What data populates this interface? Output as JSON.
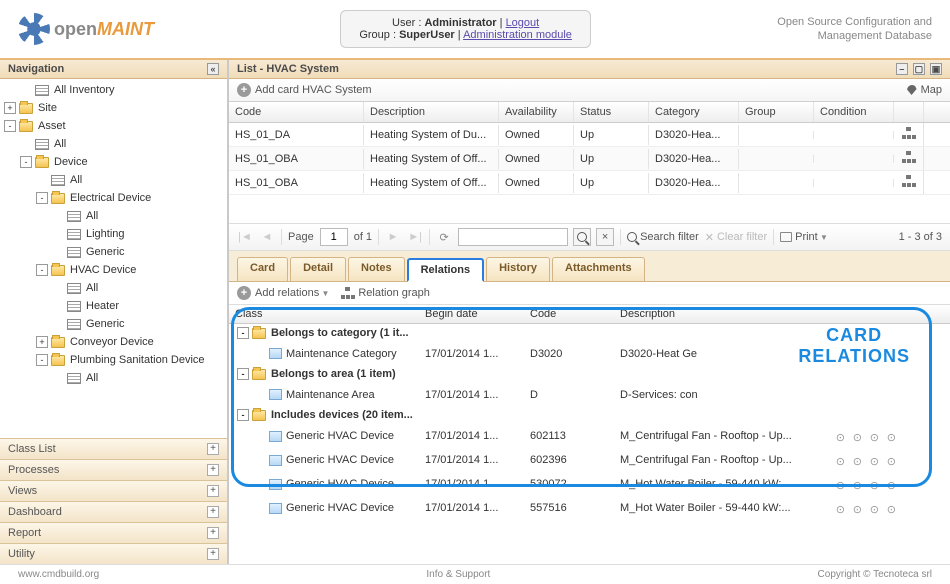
{
  "brand": {
    "part1": "open",
    "part2": "MAINT"
  },
  "header": {
    "user_label": "User :",
    "user": "Administrator",
    "logout": "Logout",
    "group_label": "Group :",
    "group": "SuperUser",
    "admin_module": "Administration module",
    "tagline1": "Open Source Configuration and",
    "tagline2": "Management Database"
  },
  "nav": {
    "title": "Navigation",
    "tree": [
      {
        "lvl": 1,
        "t": "grid",
        "exp": "",
        "label": "All Inventory"
      },
      {
        "lvl": 0,
        "t": "folder",
        "exp": "+",
        "label": "Site"
      },
      {
        "lvl": 0,
        "t": "folder",
        "exp": "-",
        "label": "Asset"
      },
      {
        "lvl": 1,
        "t": "grid",
        "exp": "",
        "label": "All"
      },
      {
        "lvl": 1,
        "t": "folder",
        "exp": "-",
        "label": "Device"
      },
      {
        "lvl": 2,
        "t": "grid",
        "exp": "",
        "label": "All"
      },
      {
        "lvl": 2,
        "t": "folder",
        "exp": "-",
        "label": "Electrical Device"
      },
      {
        "lvl": 3,
        "t": "grid",
        "exp": "",
        "label": "All"
      },
      {
        "lvl": 3,
        "t": "grid",
        "exp": "",
        "label": "Lighting"
      },
      {
        "lvl": 3,
        "t": "grid",
        "exp": "",
        "label": "Generic"
      },
      {
        "lvl": 2,
        "t": "folder",
        "exp": "-",
        "label": "HVAC Device"
      },
      {
        "lvl": 3,
        "t": "grid",
        "exp": "",
        "label": "All"
      },
      {
        "lvl": 3,
        "t": "grid",
        "exp": "",
        "label": "Heater"
      },
      {
        "lvl": 3,
        "t": "grid",
        "exp": "",
        "label": "Generic"
      },
      {
        "lvl": 2,
        "t": "folder",
        "exp": "+",
        "label": "Conveyor Device"
      },
      {
        "lvl": 2,
        "t": "folder",
        "exp": "-",
        "label": "Plumbing Sanitation Device"
      },
      {
        "lvl": 3,
        "t": "grid",
        "exp": "",
        "label": "All"
      }
    ],
    "acc": [
      "Class List",
      "Processes",
      "Views",
      "Dashboard",
      "Report",
      "Utility"
    ]
  },
  "list": {
    "title": "List - HVAC System",
    "add": "Add card HVAC System",
    "map": "Map",
    "cols": {
      "code": "Code",
      "desc": "Description",
      "avail": "Availability",
      "status": "Status",
      "cat": "Category",
      "group": "Group",
      "cond": "Condition"
    },
    "rows": [
      {
        "code": "HS_01_DA",
        "desc": "Heating System of Du...",
        "avail": "Owned",
        "status": "Up",
        "cat": "D3020-Hea...",
        "group": "",
        "cond": ""
      },
      {
        "code": "HS_01_OBA",
        "desc": "Heating System of Off...",
        "avail": "Owned",
        "status": "Up",
        "cat": "D3020-Hea...",
        "group": "",
        "cond": ""
      },
      {
        "code": "HS_01_OBA",
        "desc": "Heating System of Off...",
        "avail": "Owned",
        "status": "Up",
        "cat": "D3020-Hea...",
        "group": "",
        "cond": ""
      }
    ]
  },
  "paging": {
    "page_lbl": "Page",
    "page": "1",
    "of": "of 1",
    "search_filter": "Search filter",
    "clear_filter": "Clear filter",
    "print": "Print",
    "summary": "1 - 3 of 3"
  },
  "tabs": {
    "card": "Card",
    "detail": "Detail",
    "notes": "Notes",
    "relations": "Relations",
    "history": "History",
    "attachments": "Attachments"
  },
  "rel": {
    "add": "Add relations",
    "graph": "Relation graph",
    "cols": {
      "class": "Class",
      "begin": "Begin date",
      "code": "Code",
      "desc": "Description"
    },
    "groups": [
      {
        "title": "Belongs to category (1 it...",
        "rows": [
          {
            "class": "Maintenance Category",
            "begin": "17/01/2014 1...",
            "code": "D3020",
            "desc": "D3020-Heat Ge",
            "acts": "single"
          }
        ]
      },
      {
        "title": "Belongs to area (1 item)",
        "rows": [
          {
            "class": "Maintenance Area",
            "begin": "17/01/2014 1...",
            "code": "D",
            "desc": "D-Services: con",
            "acts": "single"
          }
        ]
      },
      {
        "title": "Includes devices (20 item...",
        "rows": [
          {
            "class": "Generic HVAC Device",
            "begin": "17/01/2014 1...",
            "code": "602113",
            "desc": "M_Centrifugal Fan - Rooftop - Up...",
            "acts": "multi"
          },
          {
            "class": "Generic HVAC Device",
            "begin": "17/01/2014 1...",
            "code": "602396",
            "desc": "M_Centrifugal Fan - Rooftop - Up...",
            "acts": "multi"
          },
          {
            "class": "Generic HVAC Device",
            "begin": "17/01/2014 1...",
            "code": "530072",
            "desc": "M_Hot Water Boiler - 59-440 kW:...",
            "acts": "multi"
          },
          {
            "class": "Generic HVAC Device",
            "begin": "17/01/2014 1...",
            "code": "557516",
            "desc": "M_Hot Water Boiler - 59-440 kW:...",
            "acts": "multi"
          }
        ]
      }
    ]
  },
  "callout": {
    "l1": "CARD",
    "l2": "RELATIONS"
  },
  "footer": {
    "left": "www.cmdbuild.org",
    "center": "Info & Support",
    "right": "Copyright © Tecnoteca srl"
  }
}
